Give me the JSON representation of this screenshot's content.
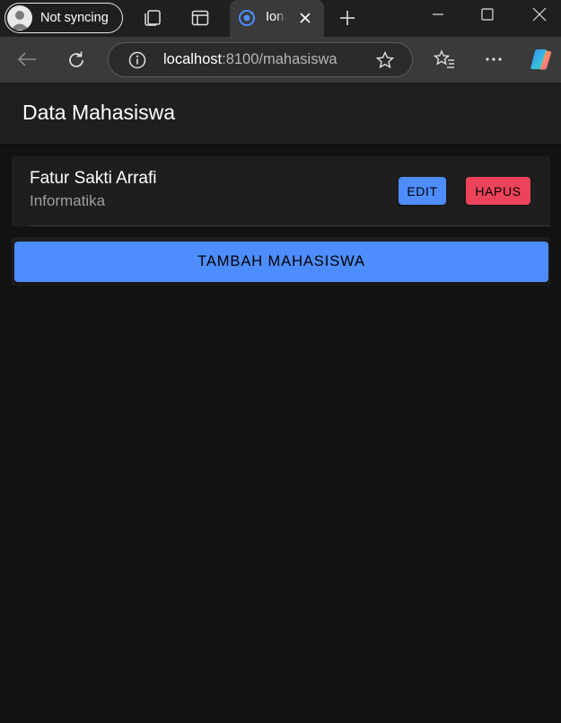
{
  "browser": {
    "profile_label": "Not syncing",
    "tab_title": "Ionic",
    "url_host": "localhost",
    "url_path": ":8100/mahasiswa",
    "colors": {
      "titlebar": "#1f1f1f",
      "navbar": "#3a3a3a",
      "tab_accent": "#4d8dff"
    },
    "icons": [
      "avatar",
      "workspaces-icon",
      "tab-actions-icon",
      "ionic-tab-icon",
      "close-tab-icon",
      "new-tab-icon",
      "minimize-icon",
      "maximize-icon",
      "close-window-icon",
      "back-icon",
      "refresh-icon",
      "info-icon",
      "favorite-star-icon",
      "favorites-icon",
      "more-icon",
      "copilot-icon"
    ]
  },
  "app": {
    "title": "Data Mahasiswa",
    "students": [
      {
        "name": "Fatur Sakti Arrafi",
        "major": "Informatika"
      }
    ],
    "edit_label": "EDIT",
    "delete_label": "HAPUS",
    "add_label": "TAMBAH MAHASISWA",
    "colors": {
      "primary": "#4d8dff",
      "danger": "#eb445a",
      "background": "#121212",
      "card": "#1e1e1e"
    }
  }
}
